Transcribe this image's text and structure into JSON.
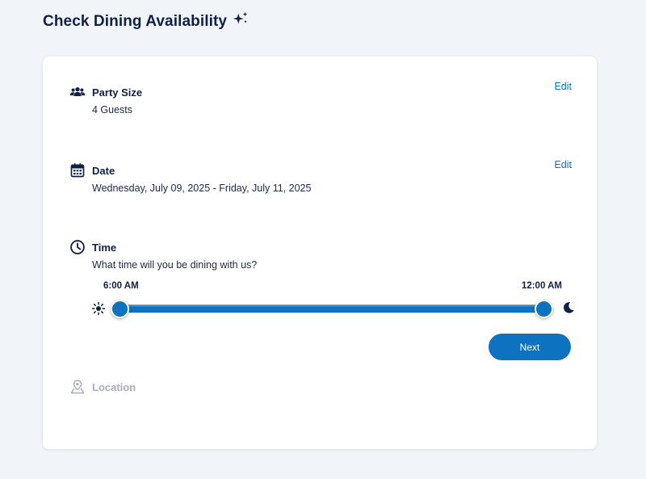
{
  "page": {
    "title": "Check Dining Availability",
    "title_icon": "sparkle-icon"
  },
  "party": {
    "icon": "group-icon",
    "title": "Party Size",
    "value": "4 Guests",
    "edit_label": "Edit"
  },
  "date": {
    "icon": "calendar-icon",
    "title": "Date",
    "value": "Wednesday, July 09, 2025 - Friday, July 11, 2025",
    "edit_label": "Edit"
  },
  "time": {
    "icon": "clock-icon",
    "title": "Time",
    "prompt": "What time will you be dining with us?",
    "start_label": "6:00 AM",
    "end_label": "12:00 AM",
    "start_icon": "sun-icon",
    "end_icon": "moon-icon",
    "range_fraction": [
      0,
      1
    ]
  },
  "next_button": {
    "label": "Next"
  },
  "location": {
    "icon": "map-pin-icon",
    "title": "Location"
  },
  "colors": {
    "accent": "#0d72bf",
    "link": "#1474c4",
    "heading": "#0f2148",
    "disabled": "#a3afc0",
    "background": "#f1f4f9"
  }
}
